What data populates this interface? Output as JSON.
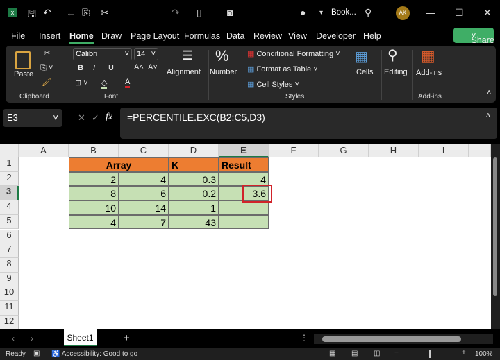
{
  "titlebar": {
    "doc_title": "Book...",
    "avatar": "AK",
    "app_icon": "excel-icon"
  },
  "menu": [
    "File",
    "Insert",
    "Home",
    "Draw",
    "Page Layout",
    "Formulas",
    "Data",
    "Review",
    "View",
    "Developer",
    "Help"
  ],
  "share": "Share",
  "ribbon": {
    "paste": "Paste",
    "clipboard": "Clipboard",
    "font_name": "Calibri",
    "font_size": "14",
    "font": "Font",
    "bold": "B",
    "italic": "I",
    "underline": "U",
    "alignment": "Alignment",
    "number": "Number",
    "cond_format": "Conditional Formatting",
    "format_table": "Format as Table",
    "cell_styles": "Cell Styles",
    "styles": "Styles",
    "cells": "Cells",
    "editing": "Editing",
    "addins": "Add-ins",
    "addins_group": "Add-ins"
  },
  "formula_bar": {
    "name_box": "E3",
    "fx": "fx",
    "formula": "=PERCENTILE.EXC(B2:C5,D3)"
  },
  "columns": [
    "A",
    "B",
    "C",
    "D",
    "E",
    "F",
    "G",
    "H",
    "I"
  ],
  "rows": [
    "1",
    "2",
    "3",
    "4",
    "5",
    "6",
    "7",
    "8",
    "9",
    "10",
    "11",
    "12"
  ],
  "table": {
    "h_array": "Array",
    "h_k": "K",
    "h_result": "Result",
    "data": [
      [
        "2",
        "4",
        "0.3",
        "4"
      ],
      [
        "8",
        "6",
        "0.2",
        "3.6"
      ],
      [
        "10",
        "14",
        "1",
        ""
      ],
      [
        "4",
        "7",
        "43",
        ""
      ]
    ]
  },
  "colors": {
    "header": "#ed7d31",
    "data": "#c6e0b4",
    "selection": "#d1232a",
    "share": "#3fae66"
  },
  "sheet_tab": "Sheet1",
  "status": {
    "ready": "Ready",
    "accessibility": "Accessibility: Good to go",
    "zoom": "100%"
  }
}
